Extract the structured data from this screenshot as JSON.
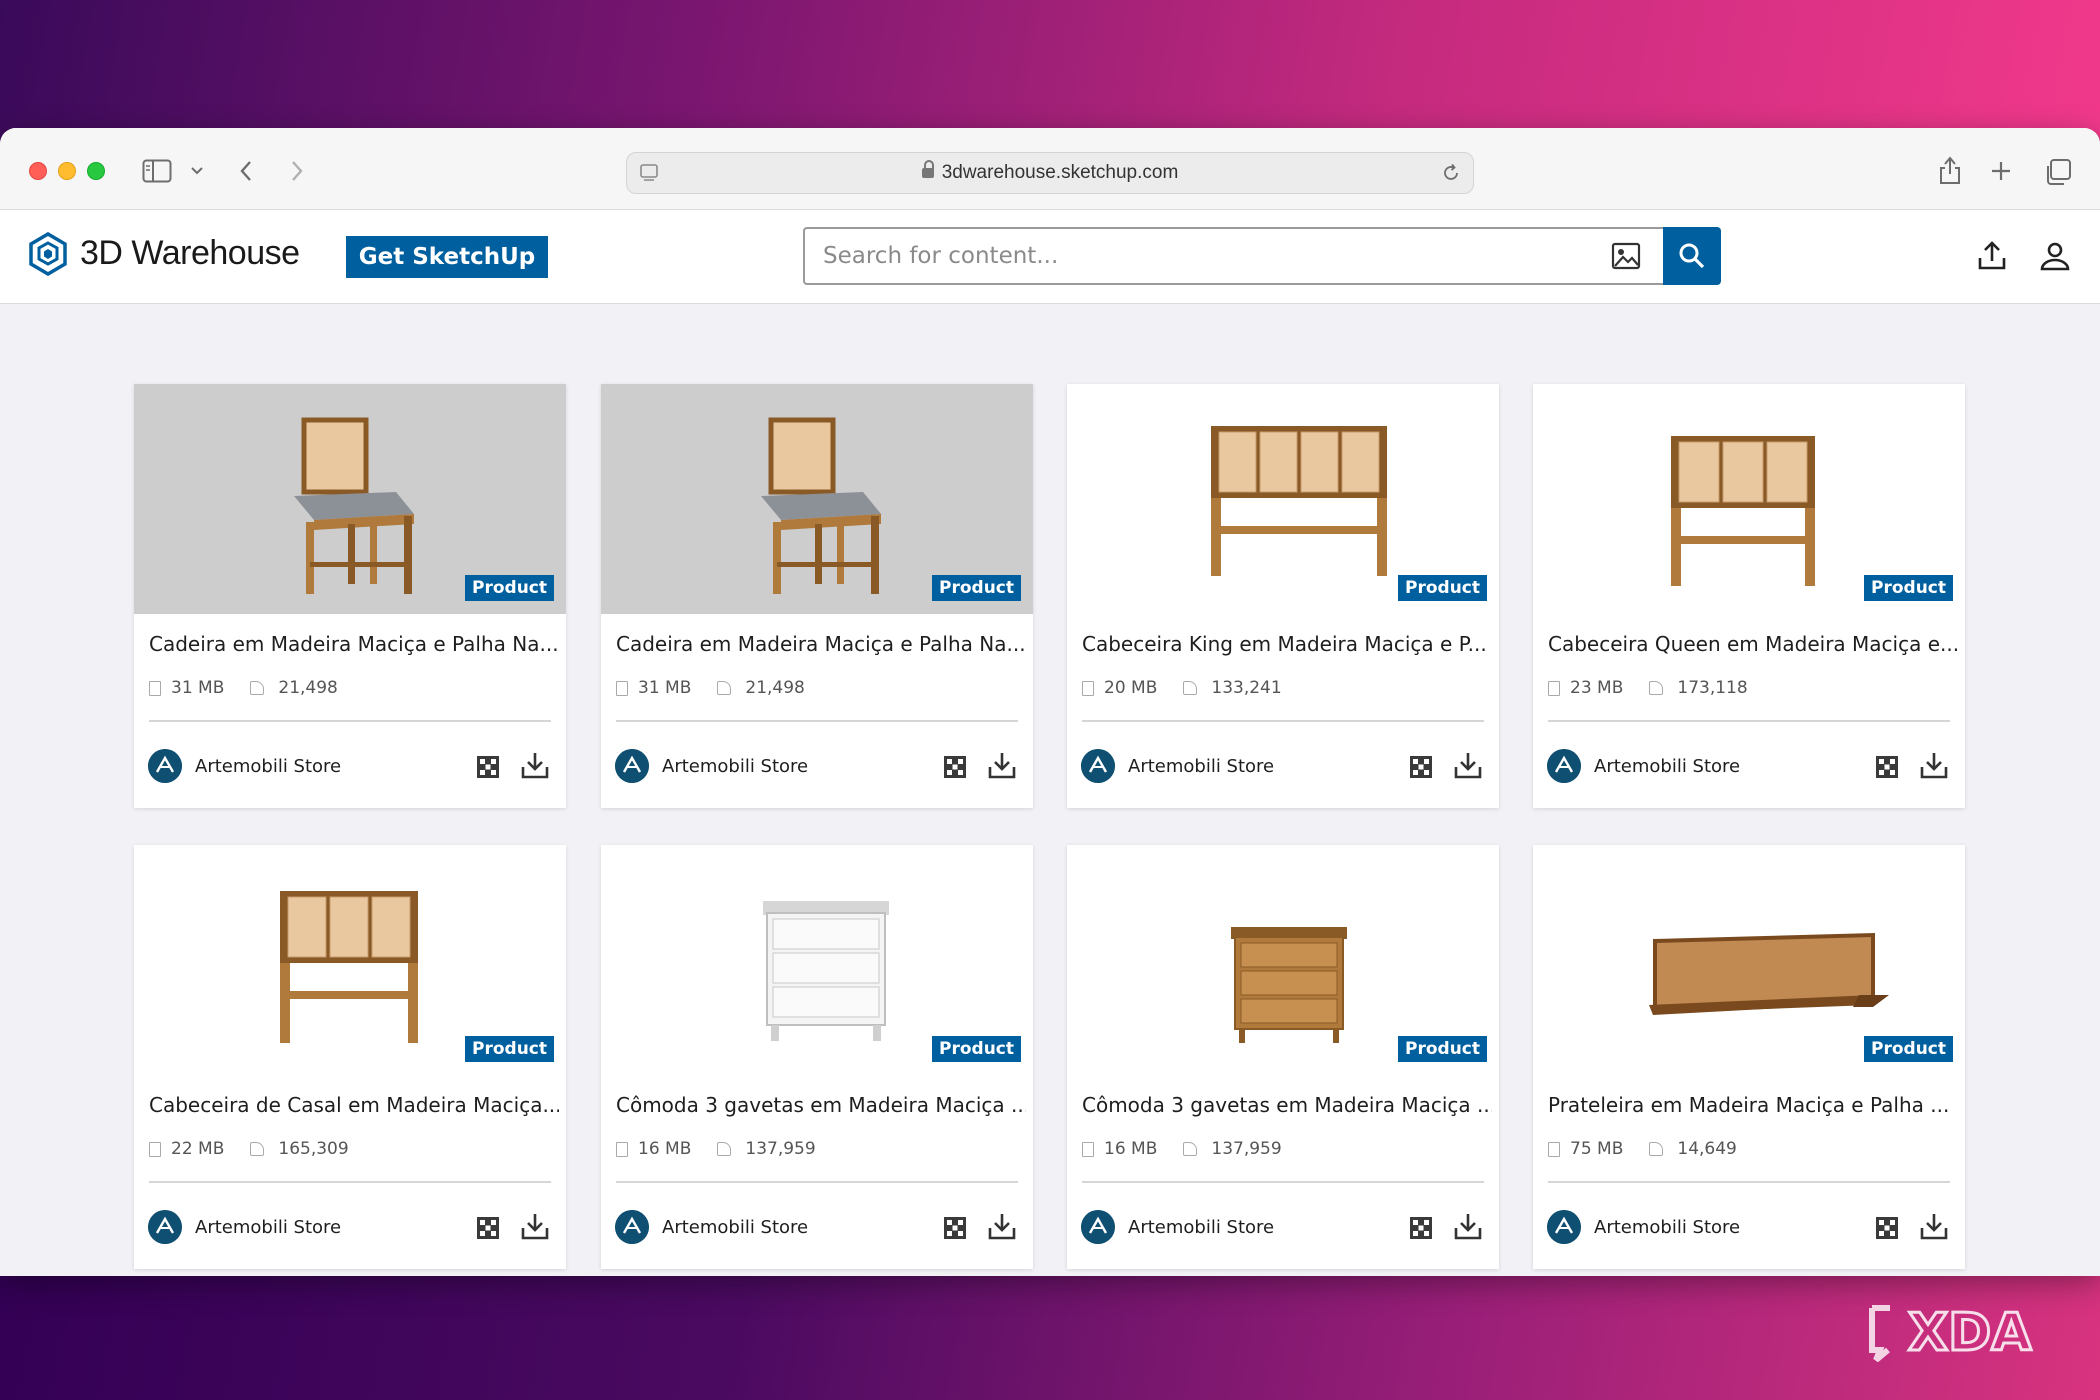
{
  "browser": {
    "url": "3dwarehouse.sketchup.com"
  },
  "header": {
    "logo_text": "3D Warehouse",
    "get_sketchup_label": "Get SketchUp",
    "search_placeholder": "Search for content..."
  },
  "colors": {
    "brand_blue": "#005f9e",
    "avatar_teal": "#0f4f72"
  },
  "cards": [
    {
      "title": "Cadeira em Madeira Maciça e Palha Na...",
      "badge": "Product",
      "size": "31 MB",
      "views": "21,498",
      "store": "Artemobili Store",
      "thumb": "chair"
    },
    {
      "title": "Cadeira em Madeira Maciça e Palha Na...",
      "badge": "Product",
      "size": "31 MB",
      "views": "21,498",
      "store": "Artemobili Store",
      "thumb": "chair"
    },
    {
      "title": "Cabeceira King em Madeira Maciça e P...",
      "badge": "Product",
      "size": "20 MB",
      "views": "133,241",
      "store": "Artemobili Store",
      "thumb": "headboard-wide"
    },
    {
      "title": "Cabeceira Queen em Madeira Maciça e...",
      "badge": "Product",
      "size": "23 MB",
      "views": "173,118",
      "store": "Artemobili Store",
      "thumb": "headboard-medium"
    },
    {
      "title": "Cabeceira de Casal em Madeira Maciça...",
      "badge": "Product",
      "size": "22 MB",
      "views": "165,309",
      "store": "Artemobili Store",
      "thumb": "headboard-narrow"
    },
    {
      "title": "Cômoda 3 gavetas em Madeira Maciça ...",
      "badge": "Product",
      "size": "16 MB",
      "views": "137,959",
      "store": "Artemobili Store",
      "thumb": "dresser-white"
    },
    {
      "title": "Cômoda 3 gavetas em Madeira Maciça ...",
      "badge": "Product",
      "size": "16 MB",
      "views": "137,959",
      "store": "Artemobili Store",
      "thumb": "dresser-wood"
    },
    {
      "title": "Prateleira em Madeira Maciça e Palha ...",
      "badge": "Product",
      "size": "75 MB",
      "views": "14,649",
      "store": "Artemobili Store",
      "thumb": "shelf"
    }
  ],
  "watermark": "XDA"
}
